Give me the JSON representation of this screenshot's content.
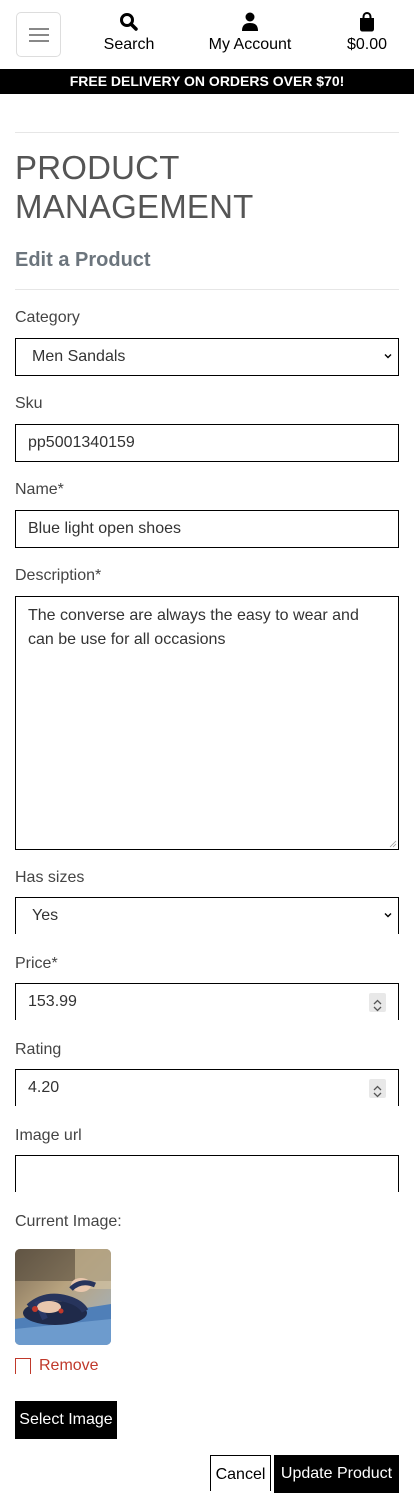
{
  "nav": {
    "search_label": "Search",
    "account_label": "My Account",
    "bag_total": "$0.00"
  },
  "banner": "FREE DELIVERY ON ORDERS OVER $70!",
  "page": {
    "title": "PRODUCT MANAGEMENT",
    "subtitle": "Edit a Product"
  },
  "form": {
    "category": {
      "label": "Category",
      "value": "Men Sandals"
    },
    "sku": {
      "label": "Sku",
      "value": "pp5001340159"
    },
    "name": {
      "label": "Name*",
      "value": "Blue light open shoes"
    },
    "description": {
      "label": "Description*",
      "value": "The converse are always the easy to wear and can be use for all occasions"
    },
    "has_sizes": {
      "label": "Has sizes",
      "value": "Yes"
    },
    "price": {
      "label": "Price*",
      "value": "153.99"
    },
    "rating": {
      "label": "Rating",
      "value": "4.20"
    },
    "image_url": {
      "label": "Image url",
      "value": ""
    },
    "current_image": {
      "label": "Current Image:"
    },
    "remove_label": "Remove",
    "select_image_label": "Select Image",
    "cancel_label": "Cancel",
    "update_label": "Update Product"
  },
  "colors": {
    "accent": "#000000",
    "danger": "#c0392b",
    "muted": "#6c757d"
  }
}
